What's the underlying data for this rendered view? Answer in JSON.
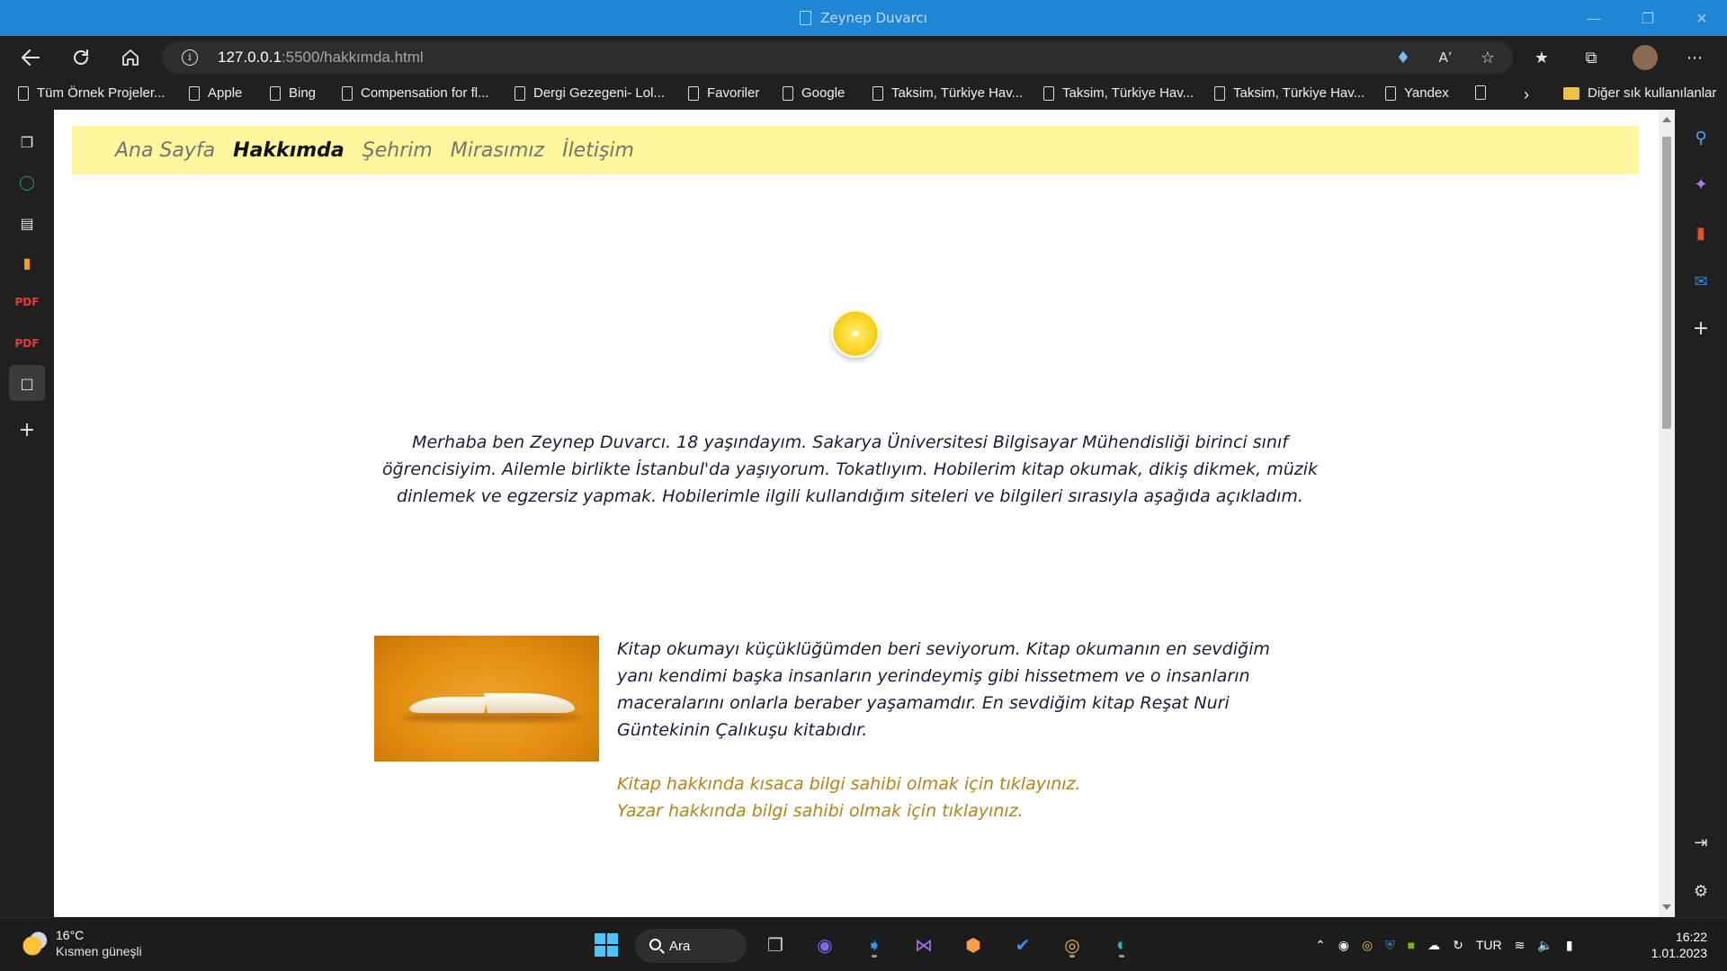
{
  "window": {
    "title": "Zeynep Duvarcı"
  },
  "address_bar": {
    "url_host": "127.0.0.1",
    "url_rest": ":5500/hakkımda.html"
  },
  "bookmarks": [
    "Tüm Örnek Projeler...",
    "Apple",
    "Bing",
    "Compensation for fl...",
    "Dergi Gezegeni- Lol...",
    "Favoriler",
    "Google",
    "Taksim, Türkiye Hav...",
    "Taksim, Türkiye Hav...",
    "Taksim, Türkiye Hav...",
    "Yandex"
  ],
  "bookmarks_other": "Diğer sık kullanılanlar",
  "site_nav": {
    "items": [
      "Ana Sayfa",
      "Hakkımda",
      "Şehrim",
      "Mirasımız",
      "İletişim"
    ],
    "current": "Hakkımda"
  },
  "intro_text": "Merhaba ben Zeynep Duvarcı. 18 yaşındayım. Sakarya Üniversitesi Bilgisayar Mühendisliği birinci sınıf öğrencisiyim. Ailemle birlikte İstanbul'da yaşıyorum. Tokatlıyım. Hobilerim kitap okumak, dikiş dikmek, müzik dinlemek ve egzersiz yapmak. Hobilerimle ilgili kullandığım siteleri ve bilgileri sırasıyla aşağıda açıkladım.",
  "book_section": {
    "text": "Kitap okumayı küçüklüğümden beri seviyorum. Kitap okumanın en sevdiğim yanı kendimi başka insanların yerindeymiş gibi hissetmem ve o insanların maceralarını onlarla beraber yaşamamdır. En sevdiğim kitap Reşat Nuri Güntekinin Çalıkuşu kitabıdır.",
    "link1": "Kitap hakkında kısaca bilgi sahibi olmak için tıklayınız.",
    "link2": "Yazar hakkında bilgi sahibi olmak için tıklayınız."
  },
  "taskbar": {
    "weather_temp": "16°C",
    "weather_cond": "Kısmen güneşli",
    "search_label": "Ara",
    "language": "TUR",
    "time": "16:22",
    "date": "1.01.2023"
  },
  "colors": {
    "titlebar": "#1f86d6",
    "site_nav_bg": "#fdf89b",
    "link": "#b38417",
    "text": "#1c1c3a"
  }
}
